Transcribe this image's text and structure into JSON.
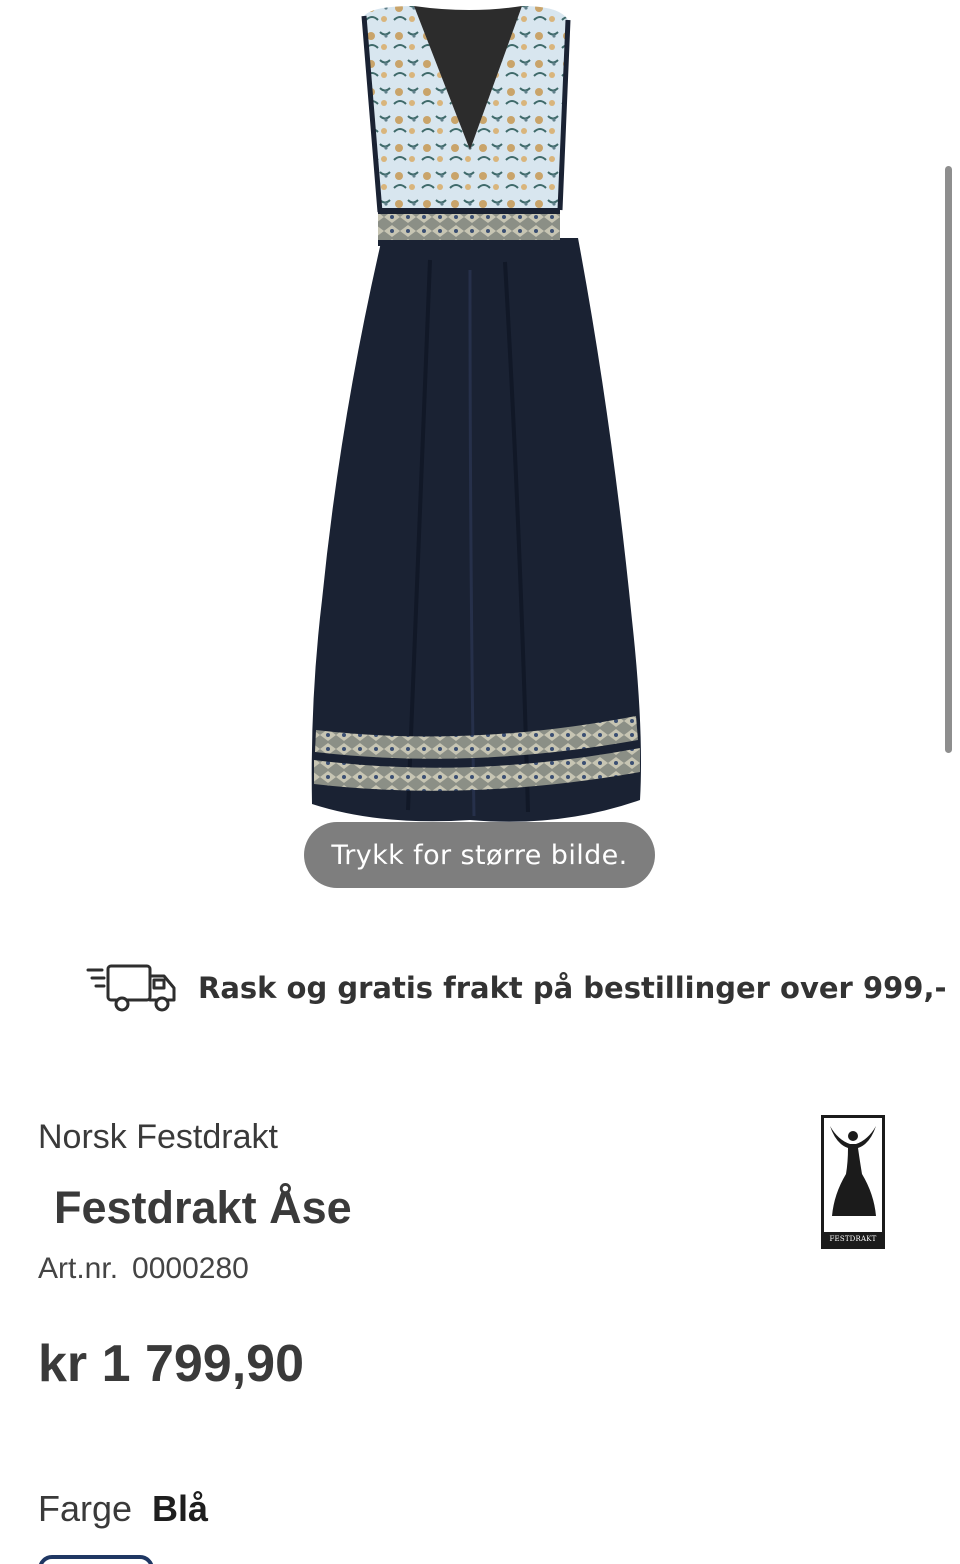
{
  "image": {
    "zoom_hint": "Trykk for større bilde."
  },
  "shipping": {
    "icon": "delivery-truck-icon",
    "text": "Rask og gratis frakt på bestillinger over 999,-"
  },
  "product": {
    "brand": "Norsk Festdrakt",
    "title": "Festdrakt Åse",
    "artnr_label": "Art.nr.",
    "artnr_value": "0000280",
    "price": "kr 1 799,90"
  },
  "brand_logo": {
    "text": "FESTDRAKT"
  },
  "color": {
    "label": "Farge",
    "value": "Blå",
    "swatch_border": "#1f3763"
  },
  "colors": {
    "dress_navy": "#1a2233",
    "bodice_blue": "#d7e5ee",
    "text": "#3a3a3a"
  }
}
